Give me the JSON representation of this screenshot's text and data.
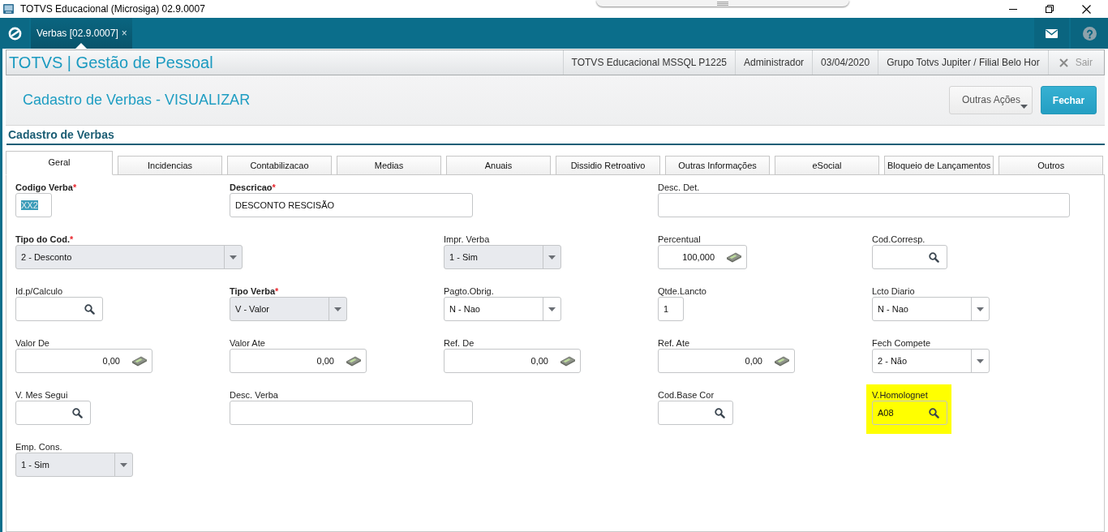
{
  "window": {
    "title": "TOTVS Educacional (Microsiga) 02.9.0007"
  },
  "app_bar": {
    "tabs": [
      {
        "label": "Verbas [02.9.0007]",
        "close": "×",
        "selected": true
      }
    ]
  },
  "header": {
    "title": "TOTVS | Gestão de Pessoal",
    "info": [
      "TOTVS Educacional MSSQL P1225",
      "Administrador",
      "03/04/2020",
      "Grupo Totvs Jupiter / Filial Belo Hor"
    ],
    "exit": {
      "label": "Sair",
      "disabled": true
    }
  },
  "page": {
    "title": "Cadastro de Verbas - VISUALIZAR",
    "buttons": [
      {
        "kind": "menu",
        "label": "Outras Ações"
      },
      {
        "kind": "primary",
        "label": "Fechar"
      }
    ]
  },
  "form": {
    "title": "Cadastro de Verbas",
    "tabs": [
      {
        "label": "Geral",
        "selected": true
      },
      {
        "label": "Incidencias",
        "selected": false
      },
      {
        "label": "Contabilizacao",
        "selected": false
      },
      {
        "label": "Medias",
        "selected": false
      },
      {
        "label": "Anuais",
        "selected": false
      },
      {
        "label": "Dissidio Retroativo",
        "selected": false
      },
      {
        "label": "Outras Informações",
        "selected": false
      },
      {
        "label": "eSocial",
        "selected": false
      },
      {
        "label": "Bloqueio de Lançamentos",
        "selected": false
      },
      {
        "label": "Outros",
        "selected": false
      }
    ],
    "rows": [
      [
        {
          "kind": "text",
          "label": "Codigo Verba",
          "required_mark": "*",
          "value": "XX2",
          "text_selected": true
        },
        {
          "kind": "text",
          "label": "Descricao",
          "required_mark": "*",
          "value": "DESCONTO RESCISÃO"
        },
        {
          "kind": "text",
          "label": "Desc. Det."
        }
      ],
      [
        {
          "kind": "select",
          "label": "Tipo do Cod.",
          "required_mark": "*",
          "value": "2 - Desconto",
          "disabled": true
        },
        {
          "kind": "select",
          "label": "Impr. Verba",
          "value": "1 - Sim",
          "disabled": true
        },
        {
          "kind": "amount",
          "label": "Percentual",
          "value": "100,000"
        },
        {
          "kind": "lookup",
          "label": "Cod.Corresp."
        }
      ],
      [
        {
          "kind": "lookup",
          "label": "Id.p/Calculo"
        },
        {
          "kind": "select",
          "label": "Tipo Verba",
          "required_mark": "*",
          "value": "V - Valor",
          "disabled": true
        },
        {
          "kind": "select",
          "label": "Pagto.Obrig.",
          "value": "N - Nao",
          "disabled": false
        },
        {
          "kind": "text",
          "label": "Qtde.Lancto",
          "value": "1"
        },
        {
          "kind": "select",
          "label": "Lcto Diario",
          "value": "N - Nao",
          "disabled": false
        }
      ],
      [
        {
          "kind": "amount",
          "label": "Valor De",
          "value": "0,00"
        },
        {
          "kind": "amount",
          "label": "Valor Ate",
          "value": "0,00"
        },
        {
          "kind": "amount",
          "label": "Ref. De",
          "value": "0,00"
        },
        {
          "kind": "amount",
          "label": "Ref. Ate",
          "value": "0,00"
        },
        {
          "kind": "select",
          "label": "Fech Compete",
          "value": "2 - Não",
          "disabled": false
        }
      ],
      [
        {
          "kind": "lookup",
          "label": "V. Mes Segui"
        },
        {
          "kind": "text",
          "label": "Desc. Verba"
        },
        {
          "kind": "lookup",
          "label": "Cod.Base Cor"
        },
        {
          "kind": "lookup",
          "label": "V.Homolognet",
          "value": "A08",
          "highlighted": true
        }
      ],
      [
        {
          "kind": "select",
          "label": "Emp. Cons.",
          "value": "1 - Sim",
          "disabled": true
        }
      ]
    ]
  }
}
